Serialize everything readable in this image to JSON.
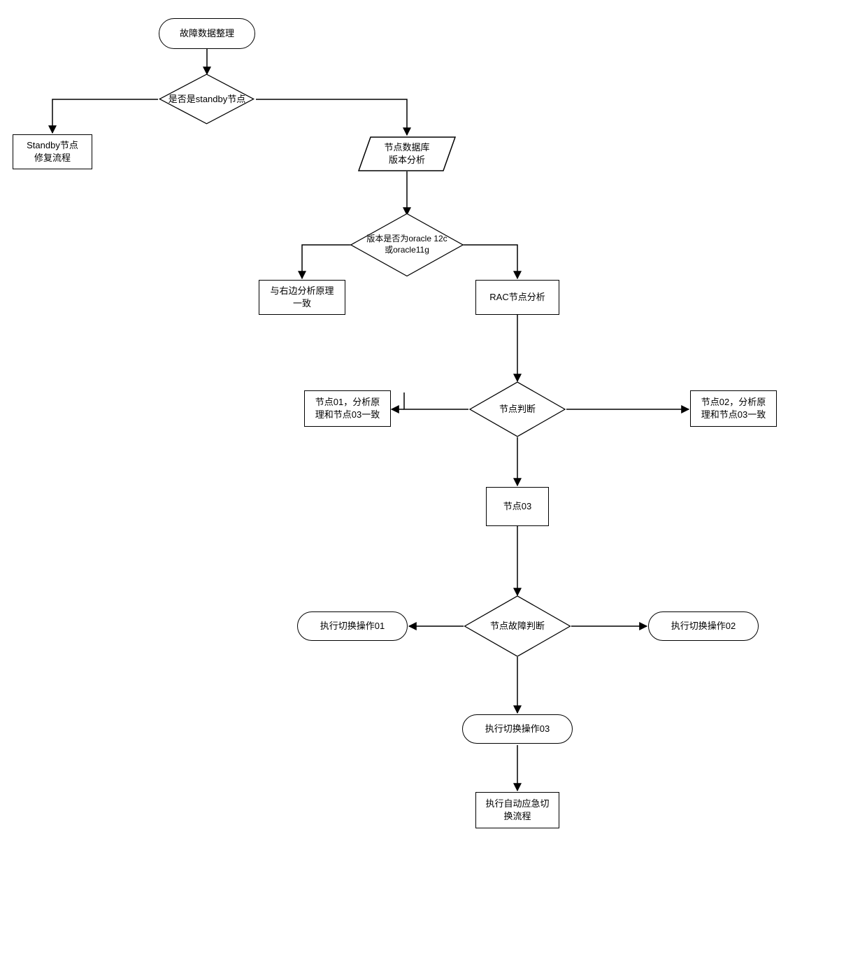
{
  "nodes": {
    "start": "故障数据整理",
    "d_standby": "是否是standby节点",
    "standby_repair": "Standby节点\n修复流程",
    "version_analysis": "节点数据库\n版本分析",
    "d_version": "版本是否为oracle 12c\n或oracle11g",
    "same_as_right": "与右边分析原理\n一致",
    "rac_analysis": "RAC节点分析",
    "d_node": "节点判断",
    "node01": "节点01，分析原\n理和节点03一致",
    "node02": "节点02，分析原\n理和节点03一致",
    "node03": "节点03",
    "d_fault": "节点故障判断",
    "op01": "执行切换操作01",
    "op02": "执行切换操作02",
    "op03": "执行切换操作03",
    "auto_switch": "执行自动应急切\n换流程"
  }
}
